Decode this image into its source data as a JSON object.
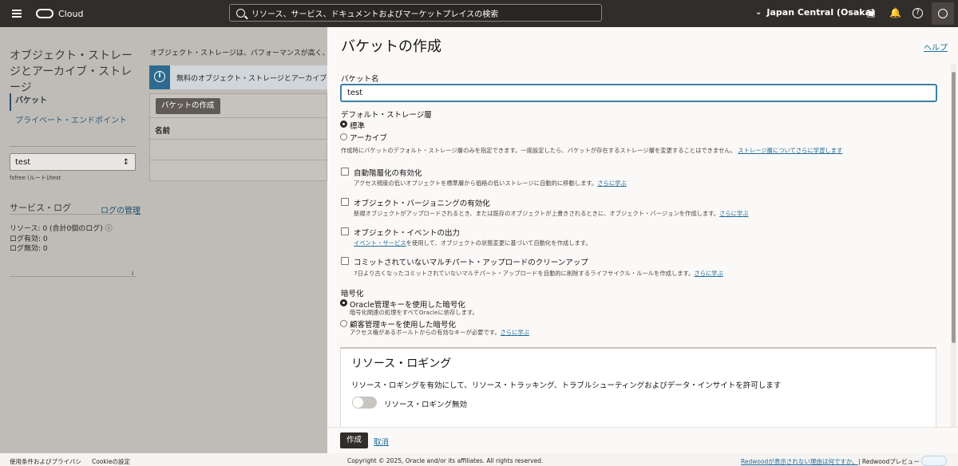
{
  "topbar": {
    "brand": "Cloud",
    "search_placeholder": "リソース、サービス、ドキュメントおよびマーケットプレイスの検索",
    "region": "Japan Central (Osaka)"
  },
  "background_page": {
    "title": "オブジェクト・ストレージとアーカイブ・ストレージ",
    "nav_buckets": "バケット",
    "nav_private_endpoints": "プライベート・エンドポイント",
    "compartment_value": "test",
    "compartment_path": "fsfree (ルート)/test",
    "service_logs": "サービス・ログ",
    "log_manage": "ログの管理",
    "resources_line": "リソース: 0 (合計0個のログ)",
    "logs_enabled": "ログ有効: 0",
    "logs_disabled": "ログ無効: 0",
    "intro": "オブジェクト・ストレージは、パフォーマンスが高く、",
    "info_text": "無料のオブジェクト・ストレージとアーカイブ",
    "create_bucket": "バケットの作成",
    "col_name": "名前",
    "small_i": "i"
  },
  "drawer": {
    "title": "バケットの作成",
    "help": "ヘルプ",
    "bucket_name_label": "バケット名",
    "bucket_name_value": "test",
    "storage_tier_label": "デフォルト・ストレージ層",
    "tier_standard": "標準",
    "tier_archive": "アーカイブ",
    "tier_note": "作成時にバケットのデフォルト・ストレージ層のみを指定できます。一度設定したら、バケットが存在するストレージ層を変更することはできません。",
    "tier_note_link": "ストレージ層についてさらに学習します",
    "auto_tiering_label": "自動階層化の有効化",
    "auto_tiering_note": "アクセス頻度の低いオブジェクトを標準層から価格の低いストレージに自動的に移動します。",
    "learn_more": "さらに学ぶ",
    "versioning_label": "オブジェクト・バージョニングの有効化",
    "versioning_note": "新規オブジェクトがアップロードされるとき、または既存のオブジェクトが上書きされるときに、オブジェクト・バージョンを作成します。",
    "events_label": "オブジェクト・イベントの出力",
    "events_link": "イベント・サービス",
    "events_note": "を使用して、オブジェクトの状態変更に基づいて自動化を作成します。",
    "multipart_label": "コミットされていないマルチパート・アップロードのクリーンアップ",
    "multipart_note": "7日より古くなったコミットされていないマルチパート・アップロードを自動的に削除するライフサイクル・ルールを作成します。",
    "encryption_label": "暗号化",
    "enc_oracle": "Oracle管理キーを使用した暗号化",
    "enc_oracle_note": "暗号化関連の処理をすべてOracleに依存します。",
    "enc_customer": "顧客管理キーを使用した暗号化",
    "enc_customer_note": "アクセス権があるボールトからの有効なキーが必要です。",
    "logging_title": "リソース・ロギング",
    "logging_desc": "リソース・ロギングを有効にして、リソース・トラッキング、トラブルシューティングおよびデータ・インサイトを許可します",
    "logging_toggle_label": "リソース・ロギング無効",
    "create_button": "作成",
    "cancel_button": "取消"
  },
  "footer": {
    "terms": "使用条件およびプライバシ",
    "cookies": "Cookieの設定",
    "copyright": "Copyright © 2025, Oracle and/or its affiliates. All rights reserved.",
    "redwood_why": "Redwoodが表示されない理由は何ですか。",
    "redwood_preview": "| Redwoodプレビュー"
  }
}
